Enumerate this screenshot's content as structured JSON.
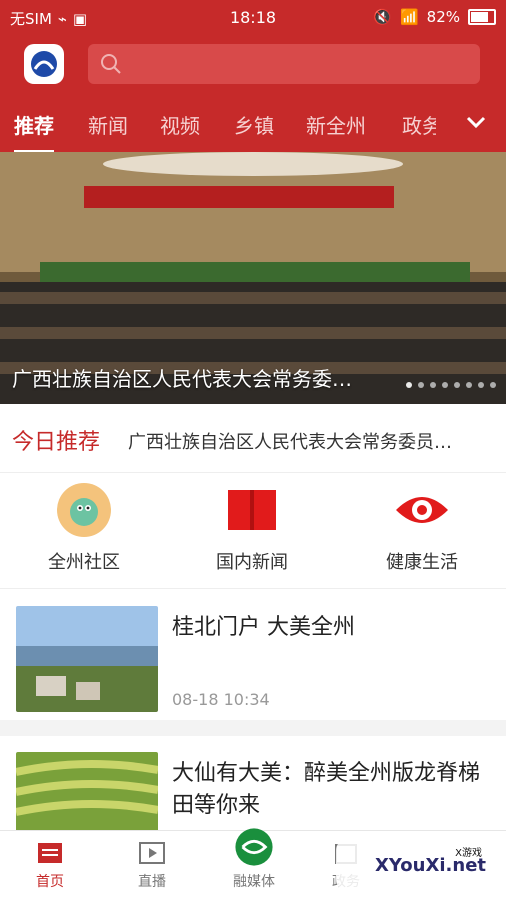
{
  "status": {
    "carrier": "无SIM",
    "time": "18:18",
    "battery": "82%"
  },
  "header": {
    "search_placeholder": ""
  },
  "tabs": [
    "推荐",
    "新闻",
    "视频",
    "乡镇",
    "新全州",
    "政务"
  ],
  "banner": {
    "caption": "广西壮族自治区人民代表大会常务委…",
    "pages": 8,
    "current_page": 1
  },
  "today": {
    "label": "今日推荐",
    "text": "广西壮族自治区人民代表大会常务委员…"
  },
  "quick": [
    {
      "label": "全州社区",
      "icon": "community-mascot-icon"
    },
    {
      "label": "国内新闻",
      "icon": "book-icon"
    },
    {
      "label": "健康生活",
      "icon": "eye-icon"
    }
  ],
  "news": [
    {
      "title": "桂北门户  大美全州",
      "time": "08-18 10:34"
    },
    {
      "title": "大仙有大美：醉美全州版龙脊梯田等你来",
      "time": ""
    }
  ],
  "bottom_nav": [
    {
      "label": "首页",
      "icon": "home-icon",
      "active": true
    },
    {
      "label": "直播",
      "icon": "play-icon",
      "active": false
    },
    {
      "label": "融媒体",
      "icon": "media-icon",
      "active": false
    },
    {
      "label": "政务",
      "icon": "gov-icon",
      "active": false
    }
  ],
  "watermark": {
    "brand": "XYouXi.net",
    "small": "X游戏"
  },
  "colors": {
    "primary": "#c62a2a"
  }
}
